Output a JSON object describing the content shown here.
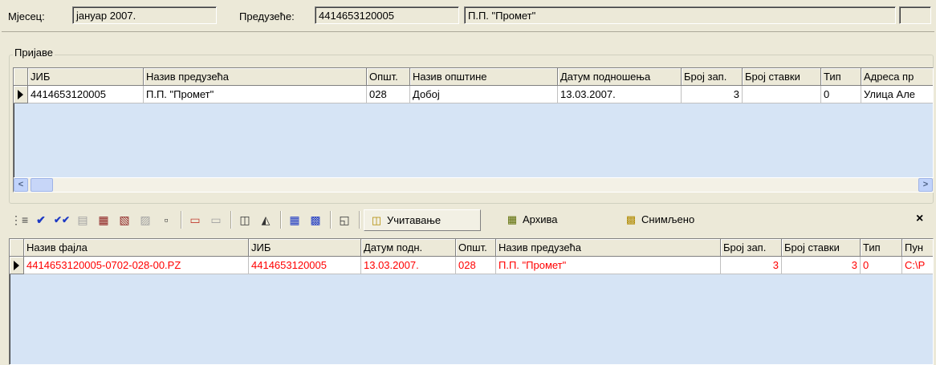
{
  "header": {
    "month_label": "Мјесец:",
    "month_value": "јануар 2007.",
    "company_label": "Предузеће:",
    "company_id": "4414653120005",
    "company_name": "П.П. \"Промет\"",
    "extra_value": ""
  },
  "registrations": {
    "group_title": "Пријаве",
    "columns": [
      "ЈИБ",
      "Назив предузећа",
      "Општ.",
      "Назив општине",
      "Датум подношења",
      "Број зап.",
      "Број ставки",
      "Тип",
      "Адреса пр"
    ],
    "rows": [
      [
        "4414653120005",
        "П.П. \"Промет\"",
        "028",
        "Добој",
        "13.03.2007.",
        "3",
        "",
        "0",
        "Улица Але"
      ]
    ]
  },
  "scrollbar": {
    "left_arrow": "<",
    "right_arrow": ">"
  },
  "toolbar": {
    "load_label": "Учитавање",
    "archive_label": "Архива",
    "saved_label": "Снимљено",
    "close_label": "×"
  },
  "files": {
    "columns": [
      "Назив фајла",
      "ЈИБ",
      "Датум подн.",
      "Општ.",
      "Назив предузећа",
      "Број зап.",
      "Број ставки",
      "Тип",
      "Пун"
    ],
    "rows": [
      [
        "4414653120005-0702-028-00.PZ",
        "4414653120005",
        "13.03.2007.",
        "028",
        "П.П. \"Промет\"",
        "3",
        "3",
        "0",
        "C:\\P"
      ]
    ]
  },
  "colors": {
    "window_bg": "#ece9d8",
    "selection_fill": "#d6e4f5",
    "highlight_text": "#ff0000"
  }
}
